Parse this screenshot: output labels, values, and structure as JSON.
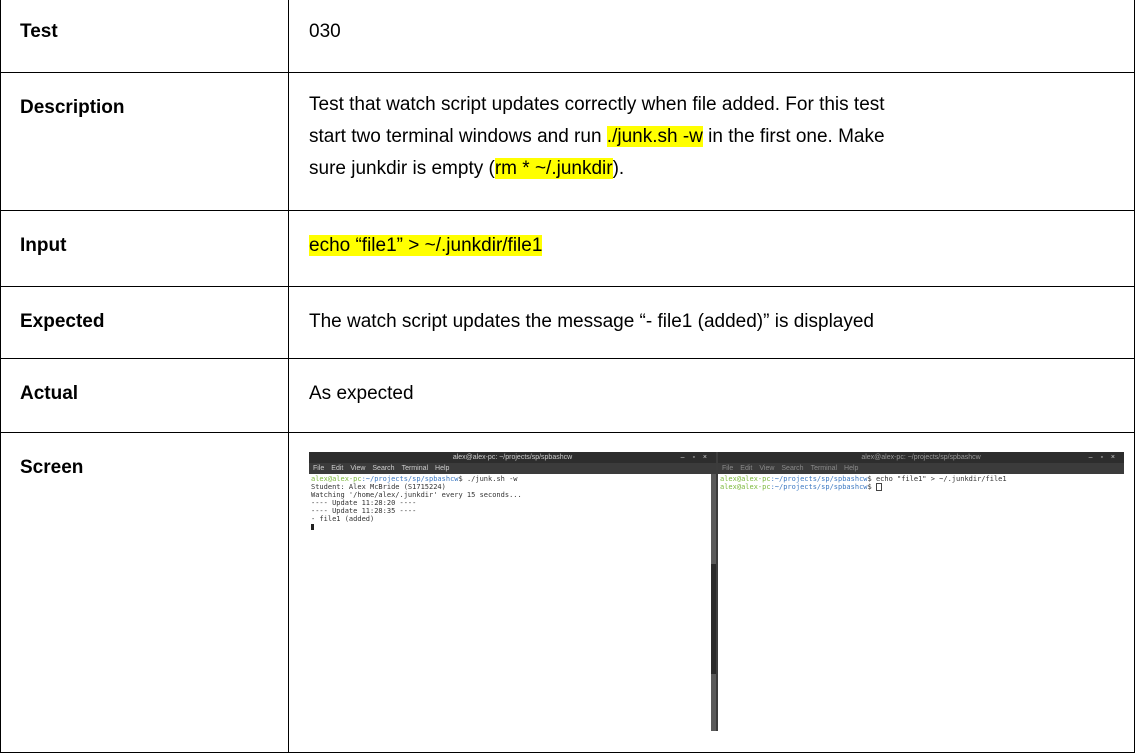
{
  "rows": {
    "test": {
      "label": "Test",
      "value": "030"
    },
    "description": {
      "label": "Description",
      "line1": "Test that watch script updates correctly when file added. For this test",
      "line2_a": "start two terminal windows and run ",
      "line2_hl": "./junk.sh -w",
      "line2_b": " in the first one. Make",
      "line3_a": "sure junkdir is empty (",
      "line3_hl": "rm * ~/.junkdir",
      "line3_b": ")."
    },
    "input": {
      "label": "Input",
      "value": "echo “file1” > ~/.junkdir/file1"
    },
    "expected": {
      "label": "Expected",
      "value": "The watch script updates the message “- file1 (added)” is displayed"
    },
    "actual": {
      "label": "Actual",
      "value": "As expected"
    },
    "screen": {
      "label": "Screen"
    }
  },
  "screenshot": {
    "terminal1": {
      "title": "alex@alex-pc: ~/projects/sp/spbashcw",
      "window_controls": "– ▫ ×",
      "menu": [
        "File",
        "Edit",
        "View",
        "Search",
        "Terminal",
        "Help"
      ],
      "prompt_user": "alex@alex-pc",
      "prompt_path": ":~/projects/sp/spbashcw",
      "command": "$ ./junk.sh -w",
      "output": [
        "Student: Alex McBride (S1715224)",
        "Watching '/home/alex/.junkdir' every 15 seconds...",
        "---- Update 11:28:20 ----",
        "---- Update 11:28:35 ----",
        "- file1 (added)"
      ]
    },
    "terminal2": {
      "title": "alex@alex-pc: ~/projects/sp/spbashcw",
      "window_controls": "– ▫ ×",
      "menu": [
        "File",
        "Edit",
        "View",
        "Search",
        "Terminal",
        "Help"
      ],
      "prompt_user": "alex@alex-pc",
      "prompt_path": ":~/projects/sp/spbashcw",
      "command": "$ echo \"file1\" > ~/.junkdir/file1",
      "prompt2_end": "$ "
    }
  },
  "colors": {
    "highlight": "#ffff00",
    "prompt_green": "#7bb83a",
    "path_blue": "#3b78c2"
  }
}
